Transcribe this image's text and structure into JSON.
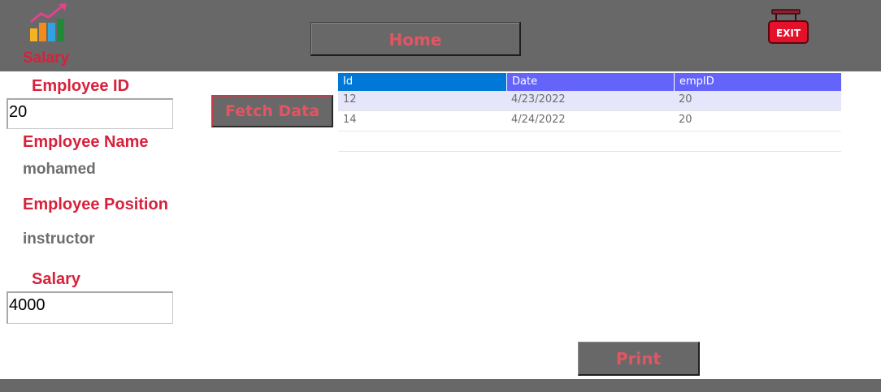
{
  "header": {
    "logo_label": "Salary",
    "home_label": "Home",
    "exit_label": "EXIT"
  },
  "form": {
    "employee_id_label": "Employee ID",
    "employee_id_value": "20",
    "employee_name_label": "Employee Name",
    "employee_name_value": "mohamed",
    "employee_position_label": "Employee Position",
    "employee_position_value": "instructor",
    "salary_label": "Salary",
    "salary_value": "4000"
  },
  "buttons": {
    "fetch_label": "Fetch Data",
    "print_label": "Print"
  },
  "table": {
    "columns": [
      "Id",
      "Date",
      "empID"
    ],
    "rows": [
      [
        "12",
        "4/23/2022",
        "20"
      ],
      [
        "14",
        "4/24/2022",
        "20"
      ]
    ]
  },
  "colors": {
    "bar": "#686868",
    "accent_red": "#d8213b",
    "button_text": "#e25563",
    "grid_header": "#6464fb",
    "grid_header_first": "#0078d7",
    "grid_selected": "#e6e6fa"
  }
}
